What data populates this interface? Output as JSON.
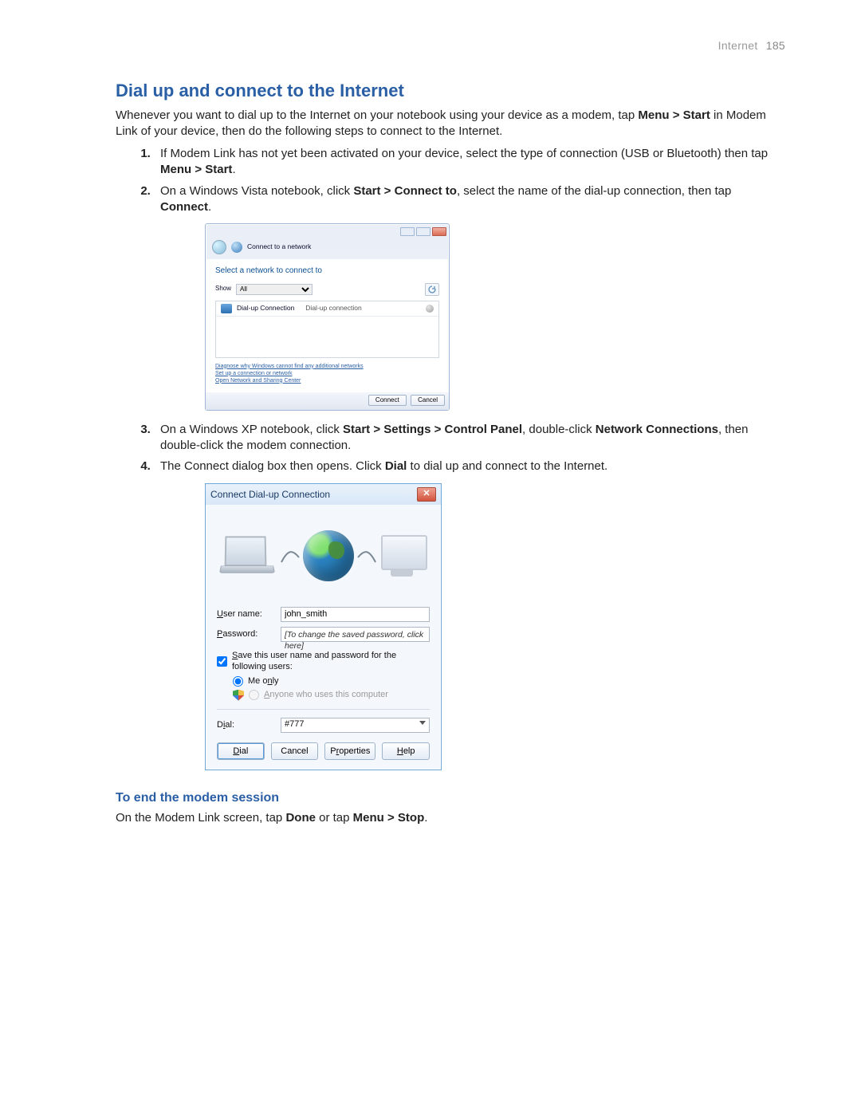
{
  "page_header": {
    "section": "Internet",
    "page_number": "185"
  },
  "heading": "Dial up and connect to the Internet",
  "intro": {
    "pre": "Whenever you want to dial up to the Internet on your notebook using your device as a modem, tap ",
    "b1": "Menu > Start",
    "mid": " in Modem Link of your device, then do the following steps to connect to the Internet."
  },
  "steps": {
    "s1": {
      "pre": "If Modem Link has not yet been activated on your device, select the type of connection (USB or Bluetooth) then tap ",
      "b1": "Menu > Start",
      "post": "."
    },
    "s2": {
      "pre": "On a Windows Vista notebook, click ",
      "b1": "Start > Connect to",
      "mid": ", select the name of the dial-up connection, then tap ",
      "b2": "Connect",
      "post": "."
    },
    "s3": {
      "pre": "On a Windows XP notebook, click ",
      "b1": "Start > Settings > Control Panel",
      "mid": ", double-click ",
      "b2": "Network Connections",
      "post": ", then double-click the modem connection."
    },
    "s4": {
      "pre": "The Connect dialog box then opens. Click ",
      "b1": "Dial",
      "post": " to dial up and connect to the Internet."
    }
  },
  "vista": {
    "window_label": "Connect to a network",
    "prompt": "Select a network to connect to",
    "show_label": "Show",
    "show_value": "All",
    "list_item_name": "Dial-up Connection",
    "list_item_type": "Dial-up connection",
    "link1": "Diagnose why Windows cannot find any additional networks",
    "link2": "Set up a connection or network",
    "link3": "Open Network and Sharing Center",
    "btn_connect": "Connect",
    "btn_cancel": "Cancel"
  },
  "xp": {
    "title": "Connect Dial-up Connection",
    "label_user": "User name:",
    "value_user": "john_smith",
    "label_pass": "Password:",
    "value_pass": "[To change the saved password, click here]",
    "save_label": "Save this user name and password for the following users:",
    "opt_me": "Me only",
    "opt_anyone": "Anyone who uses this computer",
    "label_dial": "Dial:",
    "value_dial": "#777",
    "btn_dial": "Dial",
    "btn_cancel": "Cancel",
    "btn_props": "Properties",
    "btn_help": "Help"
  },
  "end_section": {
    "heading": "To end the modem session",
    "pre": "On the Modem Link screen, tap ",
    "b1": "Done",
    "mid": " or tap ",
    "b2": "Menu > Stop",
    "post": "."
  }
}
